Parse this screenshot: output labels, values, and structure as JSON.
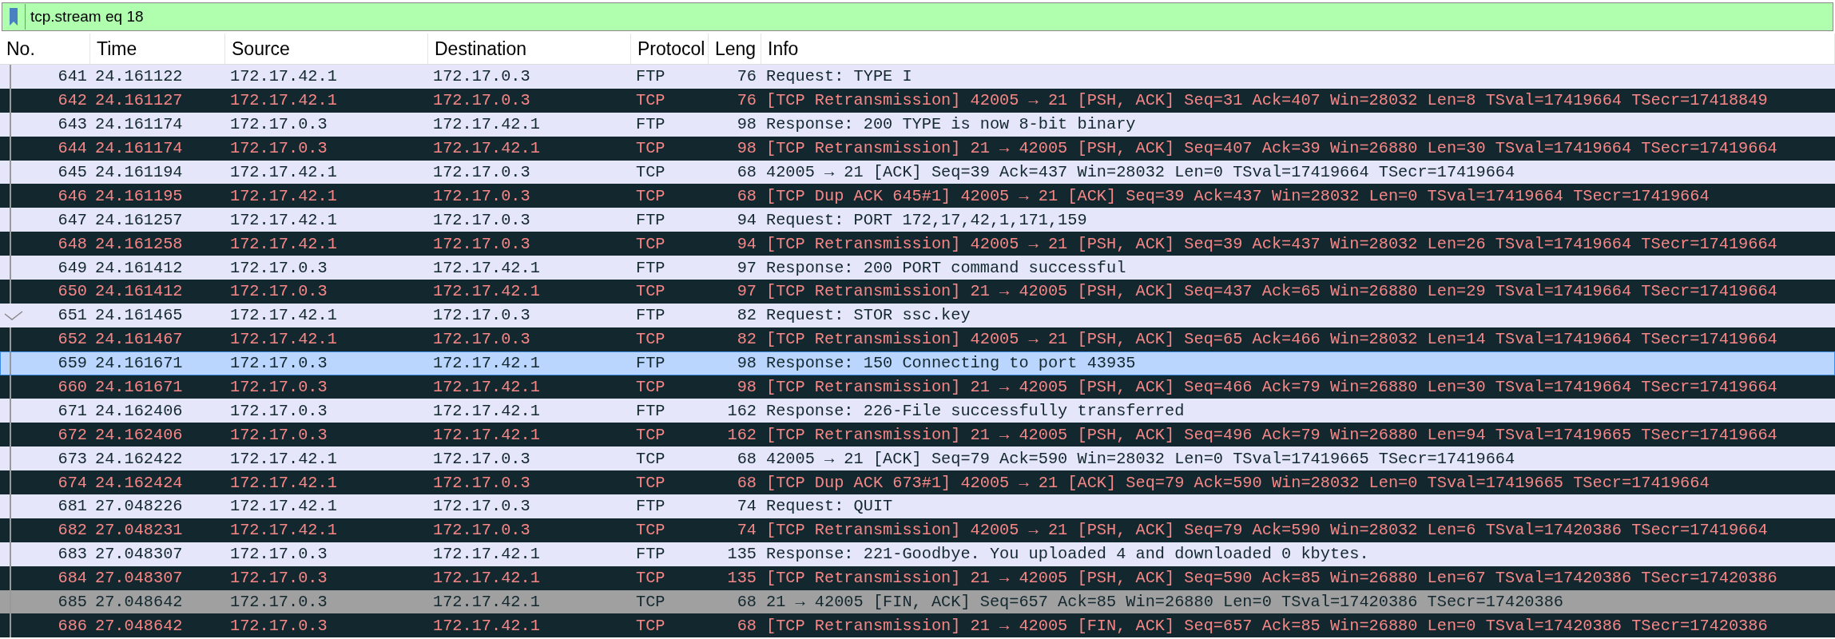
{
  "filter": {
    "value": "tcp.stream eq 18"
  },
  "columns": [
    "No.",
    "Time",
    "Source",
    "Destination",
    "Protocol",
    "Leng",
    "Info"
  ],
  "rows": [
    {
      "no": "641",
      "time": "24.161122",
      "source": "172.17.42.1",
      "destination": "172.17.0.3",
      "protocol": "FTP",
      "length": "76",
      "info": "Request: TYPE I",
      "kind": "normal",
      "acked": false,
      "selected": false
    },
    {
      "no": "642",
      "time": "24.161127",
      "source": "172.17.42.1",
      "destination": "172.17.0.3",
      "protocol": "TCP",
      "length": "76",
      "info": "[TCP Retransmission] 42005 → 21 [PSH, ACK] Seq=31 Ack=407 Win=28032 Len=8 TSval=17419664 TSecr=17418849",
      "kind": "bad",
      "acked": false,
      "selected": false
    },
    {
      "no": "643",
      "time": "24.161174",
      "source": "172.17.0.3",
      "destination": "172.17.42.1",
      "protocol": "FTP",
      "length": "98",
      "info": "Response: 200 TYPE is now 8-bit binary",
      "kind": "normal",
      "acked": false,
      "selected": false
    },
    {
      "no": "644",
      "time": "24.161174",
      "source": "172.17.0.3",
      "destination": "172.17.42.1",
      "protocol": "TCP",
      "length": "98",
      "info": "[TCP Retransmission] 21 → 42005 [PSH, ACK] Seq=407 Ack=39 Win=26880 Len=30 TSval=17419664 TSecr=17419664",
      "kind": "bad",
      "acked": false,
      "selected": false
    },
    {
      "no": "645",
      "time": "24.161194",
      "source": "172.17.42.1",
      "destination": "172.17.0.3",
      "protocol": "TCP",
      "length": "68",
      "info": "42005 → 21 [ACK] Seq=39 Ack=437 Win=28032 Len=0 TSval=17419664 TSecr=17419664",
      "kind": "normal",
      "acked": false,
      "selected": false
    },
    {
      "no": "646",
      "time": "24.161195",
      "source": "172.17.42.1",
      "destination": "172.17.0.3",
      "protocol": "TCP",
      "length": "68",
      "info": "[TCP Dup ACK 645#1] 42005 → 21 [ACK] Seq=39 Ack=437 Win=28032 Len=0 TSval=17419664 TSecr=17419664",
      "kind": "bad",
      "acked": false,
      "selected": false
    },
    {
      "no": "647",
      "time": "24.161257",
      "source": "172.17.42.1",
      "destination": "172.17.0.3",
      "protocol": "FTP",
      "length": "94",
      "info": "Request: PORT 172,17,42,1,171,159",
      "kind": "normal",
      "acked": false,
      "selected": false
    },
    {
      "no": "648",
      "time": "24.161258",
      "source": "172.17.42.1",
      "destination": "172.17.0.3",
      "protocol": "TCP",
      "length": "94",
      "info": "[TCP Retransmission] 42005 → 21 [PSH, ACK] Seq=39 Ack=437 Win=28032 Len=26 TSval=17419664 TSecr=17419664",
      "kind": "bad",
      "acked": false,
      "selected": false
    },
    {
      "no": "649",
      "time": "24.161412",
      "source": "172.17.0.3",
      "destination": "172.17.42.1",
      "protocol": "FTP",
      "length": "97",
      "info": "Response: 200 PORT command successful",
      "kind": "normal",
      "acked": false,
      "selected": false
    },
    {
      "no": "650",
      "time": "24.161412",
      "source": "172.17.0.3",
      "destination": "172.17.42.1",
      "protocol": "TCP",
      "length": "97",
      "info": "[TCP Retransmission] 21 → 42005 [PSH, ACK] Seq=437 Ack=65 Win=26880 Len=29 TSval=17419664 TSecr=17419664",
      "kind": "bad",
      "acked": false,
      "selected": false
    },
    {
      "no": "651",
      "time": "24.161465",
      "source": "172.17.42.1",
      "destination": "172.17.0.3",
      "protocol": "FTP",
      "length": "82",
      "info": "Request: STOR ssc.key",
      "kind": "normal",
      "acked": true,
      "selected": false
    },
    {
      "no": "652",
      "time": "24.161467",
      "source": "172.17.42.1",
      "destination": "172.17.0.3",
      "protocol": "TCP",
      "length": "82",
      "info": "[TCP Retransmission] 42005 → 21 [PSH, ACK] Seq=65 Ack=466 Win=28032 Len=14 TSval=17419664 TSecr=17419664",
      "kind": "bad",
      "acked": false,
      "selected": false
    },
    {
      "no": "659",
      "time": "24.161671",
      "source": "172.17.0.3",
      "destination": "172.17.42.1",
      "protocol": "FTP",
      "length": "98",
      "info": "Response: 150 Connecting to port 43935",
      "kind": "normal",
      "acked": false,
      "selected": true
    },
    {
      "no": "660",
      "time": "24.161671",
      "source": "172.17.0.3",
      "destination": "172.17.42.1",
      "protocol": "TCP",
      "length": "98",
      "info": "[TCP Retransmission] 21 → 42005 [PSH, ACK] Seq=466 Ack=79 Win=26880 Len=30 TSval=17419664 TSecr=17419664",
      "kind": "bad",
      "acked": false,
      "selected": false
    },
    {
      "no": "671",
      "time": "24.162406",
      "source": "172.17.0.3",
      "destination": "172.17.42.1",
      "protocol": "FTP",
      "length": "162",
      "info": "Response: 226-File successfully transferred",
      "kind": "normal",
      "acked": false,
      "selected": false
    },
    {
      "no": "672",
      "time": "24.162406",
      "source": "172.17.0.3",
      "destination": "172.17.42.1",
      "protocol": "TCP",
      "length": "162",
      "info": "[TCP Retransmission] 21 → 42005 [PSH, ACK] Seq=496 Ack=79 Win=26880 Len=94 TSval=17419665 TSecr=17419664",
      "kind": "bad",
      "acked": false,
      "selected": false
    },
    {
      "no": "673",
      "time": "24.162422",
      "source": "172.17.42.1",
      "destination": "172.17.0.3",
      "protocol": "TCP",
      "length": "68",
      "info": "42005 → 21 [ACK] Seq=79 Ack=590 Win=28032 Len=0 TSval=17419665 TSecr=17419664",
      "kind": "normal",
      "acked": false,
      "selected": false
    },
    {
      "no": "674",
      "time": "24.162424",
      "source": "172.17.42.1",
      "destination": "172.17.0.3",
      "protocol": "TCP",
      "length": "68",
      "info": "[TCP Dup ACK 673#1] 42005 → 21 [ACK] Seq=79 Ack=590 Win=28032 Len=0 TSval=17419665 TSecr=17419664",
      "kind": "bad",
      "acked": false,
      "selected": false
    },
    {
      "no": "681",
      "time": "27.048226",
      "source": "172.17.42.1",
      "destination": "172.17.0.3",
      "protocol": "FTP",
      "length": "74",
      "info": "Request: QUIT",
      "kind": "normal",
      "acked": false,
      "selected": false
    },
    {
      "no": "682",
      "time": "27.048231",
      "source": "172.17.42.1",
      "destination": "172.17.0.3",
      "protocol": "TCP",
      "length": "74",
      "info": "[TCP Retransmission] 42005 → 21 [PSH, ACK] Seq=79 Ack=590 Win=28032 Len=6 TSval=17420386 TSecr=17419664",
      "kind": "bad",
      "acked": false,
      "selected": false
    },
    {
      "no": "683",
      "time": "27.048307",
      "source": "172.17.0.3",
      "destination": "172.17.42.1",
      "protocol": "FTP",
      "length": "135",
      "info": "Response: 221-Goodbye. You uploaded 4 and downloaded 0 kbytes.",
      "kind": "normal",
      "acked": false,
      "selected": false
    },
    {
      "no": "684",
      "time": "27.048307",
      "source": "172.17.0.3",
      "destination": "172.17.42.1",
      "protocol": "TCP",
      "length": "135",
      "info": "[TCP Retransmission] 21 → 42005 [PSH, ACK] Seq=590 Ack=85 Win=26880 Len=67 TSval=17420386 TSecr=17420386",
      "kind": "bad",
      "acked": false,
      "selected": false
    },
    {
      "no": "685",
      "time": "27.048642",
      "source": "172.17.0.3",
      "destination": "172.17.42.1",
      "protocol": "TCP",
      "length": "68",
      "info": "21 → 42005 [FIN, ACK] Seq=657 Ack=85 Win=26880 Len=0 TSval=17420386 TSecr=17420386",
      "kind": "fin",
      "acked": false,
      "selected": false
    },
    {
      "no": "686",
      "time": "27.048642",
      "source": "172.17.0.3",
      "destination": "172.17.42.1",
      "protocol": "TCP",
      "length": "68",
      "info": "[TCP Retransmission] 21 → 42005 [FIN, ACK] Seq=657 Ack=85 Win=26880 Len=0 TSval=17420386 TSecr=17420386",
      "kind": "bad",
      "acked": false,
      "selected": false
    }
  ]
}
